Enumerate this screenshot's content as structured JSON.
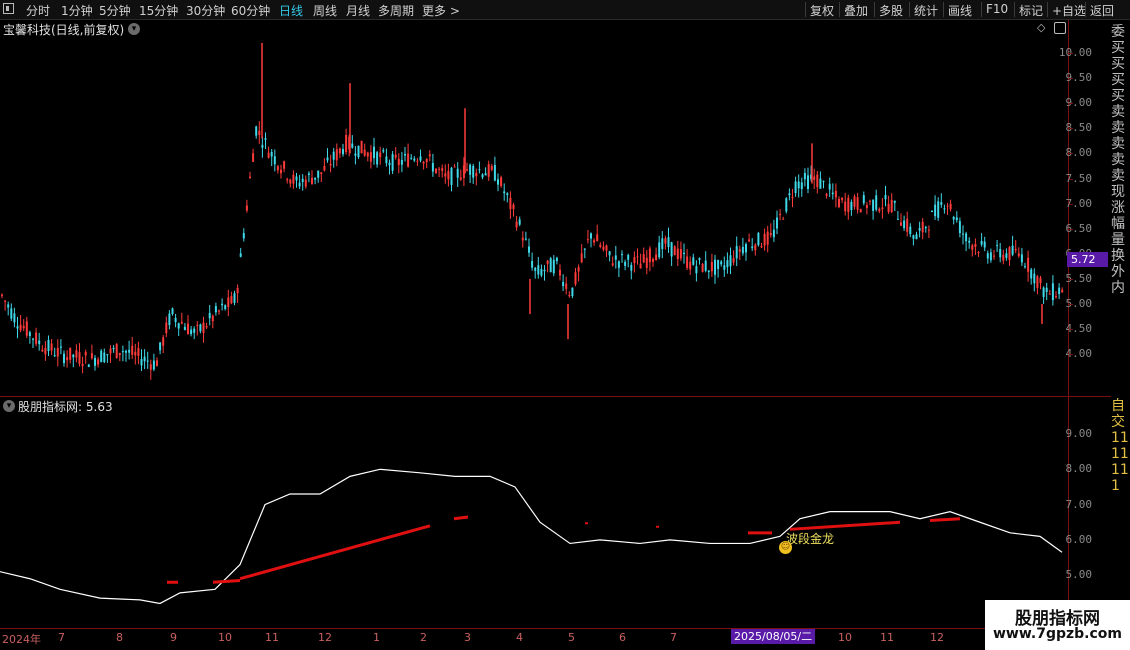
{
  "toolbar": {
    "menu_icon": "window-menu-icon",
    "periods": [
      {
        "label": "分时"
      },
      {
        "label": "1分钟"
      },
      {
        "label": "5分钟"
      },
      {
        "label": "15分钟"
      },
      {
        "label": "30分钟"
      },
      {
        "label": "60分钟"
      },
      {
        "label": "日线",
        "active": true
      },
      {
        "label": "周线"
      },
      {
        "label": "月线"
      },
      {
        "label": "多周期"
      },
      {
        "label": "更多 >"
      }
    ],
    "right_buttons": [
      {
        "label": "复权"
      },
      {
        "label": "叠加"
      },
      {
        "label": "多股"
      },
      {
        "label": "统计"
      },
      {
        "label": "画线"
      },
      {
        "label": "F10"
      },
      {
        "label": "标记"
      },
      {
        "label": "+自选"
      },
      {
        "label": "返回"
      }
    ]
  },
  "main_chart": {
    "title": "宝馨科技(日线,前复权)",
    "dropdown_icon": "chevron-down-icon",
    "diamond_icon": "diamond-icon",
    "y_labels": [
      "10.00",
      "9.50",
      "9.00",
      "8.50",
      "8.00",
      "7.50",
      "7.00",
      "6.50",
      "6.00",
      "5.50",
      "5.00",
      "4.50",
      "4.00"
    ],
    "current_price": "5.72"
  },
  "indicator": {
    "title": "股朋指标网",
    "value": ": 5.63",
    "y_labels": [
      "9.00",
      "8.00",
      "7.00",
      "6.00",
      "5.00"
    ],
    "signal_label": "波段金龙",
    "signal_icon": "smiley-icon"
  },
  "x_axis": {
    "labels": [
      {
        "text": "2024年"
      },
      {
        "text": "7"
      },
      {
        "text": "8"
      },
      {
        "text": "9"
      },
      {
        "text": "10"
      },
      {
        "text": "11"
      },
      {
        "text": "12"
      },
      {
        "text": "1"
      },
      {
        "text": "2"
      },
      {
        "text": "3"
      },
      {
        "text": "4"
      },
      {
        "text": "5"
      },
      {
        "text": "6"
      },
      {
        "text": "7"
      },
      {
        "text": "10"
      },
      {
        "text": "11"
      },
      {
        "text": "12"
      }
    ],
    "highlight_date": "2025/08/05/二"
  },
  "watermark": {
    "line1": "股朋指标网",
    "line2": "www.7gpzb.com"
  },
  "colors": {
    "up": "#ff3b3b",
    "down": "#3fd8e8",
    "line": "#ffffff",
    "signal": "#e01010",
    "accent": "#5a1aa8"
  }
}
